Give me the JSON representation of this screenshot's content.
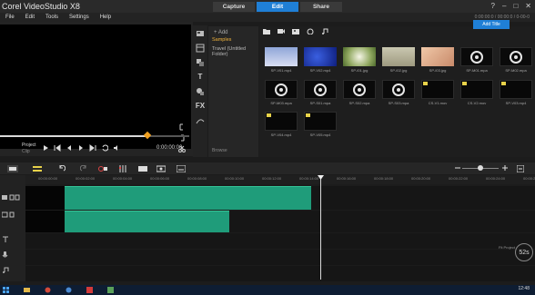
{
  "app": {
    "title": "Corel VideoStudio X8",
    "modes": [
      "Capture",
      "Edit",
      "Share"
    ],
    "active_mode": "Edit",
    "window_controls": [
      "?",
      "–",
      "□",
      "✕"
    ]
  },
  "menu": {
    "items": [
      "File",
      "Edit",
      "Tools",
      "Settings",
      "Help"
    ],
    "project_info": "0:00:00:0 / 00:00:0 / 0-00-0"
  },
  "player": {
    "project_label": "Project",
    "clip_label": "Clip",
    "timecode": "0:00:00:00",
    "transport_icons": [
      "play-icon",
      "home-icon",
      "prev-frame-icon",
      "next-frame-icon",
      "end-icon",
      "repeat-icon",
      "volume-icon"
    ],
    "side_icons": [
      "mark-in-icon",
      "mark-out-icon",
      "cut-icon"
    ]
  },
  "library": {
    "tool_icons": [
      "media-icon",
      "instant-project-icon",
      "transition-icon",
      "title-icon",
      "graphic-icon",
      "fx-icon",
      "path-icon"
    ],
    "fx_label": "FX",
    "title_label": "T",
    "folder_add": "+ Add",
    "folders": [
      "Samples",
      "Travel (Untitled Folder)"
    ],
    "active_folder": "Samples",
    "browse_label": "Browse",
    "titles_button": "Add Title",
    "media_toolbar_icons": [
      "folder-icon",
      "video-filter-icon",
      "photo-filter-icon",
      "audio-filter-icon",
      "music-note-icon"
    ],
    "items": [
      {
        "name": "SP-V01.mp4",
        "kind": "video",
        "style": "t-sample-blue"
      },
      {
        "name": "SP-V02.mp4",
        "kind": "video",
        "style": "t-blue"
      },
      {
        "name": "SP-I01.jpg",
        "kind": "image",
        "style": "t-dandelion"
      },
      {
        "name": "SP-I02.jpg",
        "kind": "image",
        "style": "t-wheat"
      },
      {
        "name": "SP-I03.jpg",
        "kind": "image",
        "style": "t-peach"
      },
      {
        "name": "SP-M01.mpa",
        "kind": "audio",
        "style": "audio"
      },
      {
        "name": "SP-M02.mpa",
        "kind": "audio",
        "style": "audio"
      },
      {
        "name": "SP-M03.mpa",
        "kind": "audio",
        "style": "audio"
      },
      {
        "name": "SP-S01.mpa",
        "kind": "audio",
        "style": "audio"
      },
      {
        "name": "SP-S02.mpa",
        "kind": "audio",
        "style": "audio"
      },
      {
        "name": "SP-S03.mpa",
        "kind": "audio",
        "style": "audio"
      },
      {
        "name": "CS-V1.mov",
        "kind": "video",
        "style": "t-black"
      },
      {
        "name": "CS-V2.mov",
        "kind": "video",
        "style": "t-black"
      },
      {
        "name": "SP-V03.mp4",
        "kind": "video",
        "style": "t-black"
      },
      {
        "name": "SP-V04.mp4",
        "kind": "video",
        "style": "t-black"
      },
      {
        "name": "SP-V05.mp4",
        "kind": "video",
        "style": "t-black"
      }
    ]
  },
  "timeline": {
    "toolbar_icons": [
      "storyboard-view-icon",
      "timeline-view-icon",
      "undo-icon",
      "redo-icon",
      "record-capture-icon",
      "sound-mixer-icon",
      "auto-music-icon",
      "motion-tracking-icon",
      "subtitle-editor-icon"
    ],
    "zoom_icons": [
      "zoom-out-icon",
      "zoom-in-icon",
      "fit-project-icon"
    ],
    "ruler_ticks": [
      "00:00:00:00",
      "00:00:02:00",
      "00:00:04:00",
      "00:00:06:00",
      "00:00:08:00",
      "00:00:10:00",
      "00:00:12:00",
      "00:00:14:00",
      "00:00:16:00",
      "00:00:18:00",
      "00:00:20:00",
      "00:00:22:00",
      "00:00:24:00",
      "00:00:26:00"
    ],
    "track_labels": [
      "Video",
      "Overlay",
      "Title",
      "Voice",
      "Music"
    ],
    "fit_value": "52s",
    "fit_label": "Fit Project"
  },
  "taskbar": {
    "clock": "12:48"
  }
}
